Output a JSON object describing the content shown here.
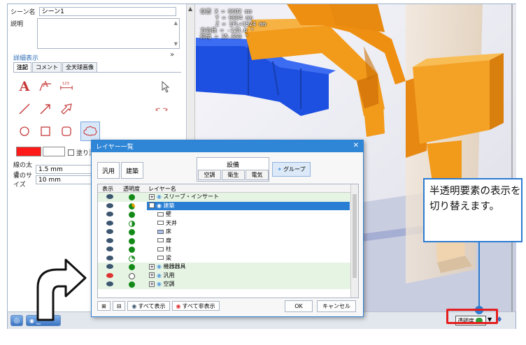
{
  "left": {
    "scene_label": "シーン名",
    "scene_value": "シーン1",
    "memo_label": "説明",
    "detail_label": "詳細表示",
    "tabs": [
      "注記",
      "コメント",
      "全天球画像"
    ],
    "fill_label": "塗り潰し",
    "line_width_label": "線の太さ",
    "line_width_value": "1.5 mm",
    "cloud_size_label": "雲のサイズ",
    "cloud_size_value": "10 mm",
    "tools": {
      "text_a": "A",
      "text_a2": "A",
      "text_123": "123"
    }
  },
  "viewport": {
    "coords": [
      "位置 X = 6602 mm",
      "Y = 6604 mm",
      "Z = 1FL+1524 mm",
      "方向角 = -128.6 °",
      "仰角 = 35.858 °"
    ]
  },
  "dialog": {
    "title": "レイヤー一覧",
    "cats": {
      "general": "汎用",
      "building": "建築",
      "equipment": "設備",
      "hvac": "空調",
      "sanitary": "衛生",
      "electric": "電気",
      "group": "グループ"
    },
    "headers": {
      "show": "表示",
      "opacity": "透明度",
      "name": "レイヤー名"
    },
    "rows": [
      {
        "name": "スリーブ・インサート",
        "expander": "⊞",
        "green": true
      },
      {
        "name": "建築",
        "expander": "⊟",
        "selected": true
      },
      {
        "name": "壁"
      },
      {
        "name": "天井"
      },
      {
        "name": "床"
      },
      {
        "name": "扉"
      },
      {
        "name": "柱"
      },
      {
        "name": "梁"
      },
      {
        "name": "機器器具",
        "expander": "⊞",
        "green": true
      },
      {
        "name": "汎用",
        "expander": "⊞",
        "green": true
      },
      {
        "name": "空調",
        "expander": "⊞",
        "green": true
      }
    ],
    "show_all": "すべて表示",
    "hide_all": "すべて非表示",
    "ok": "OK",
    "cancel": "キャンセル"
  },
  "status": {
    "layer_button": "レイヤー",
    "transparency_button": "透明度"
  },
  "callout": {
    "line1": "半透明要素の表示を",
    "line2": "切り替えます。"
  },
  "colors": {
    "duct_orange": "#f29a1a",
    "duct_blue": "#1d4fe0",
    "accent": "#2b7bd1",
    "highlight_red": "#e41e1e"
  }
}
